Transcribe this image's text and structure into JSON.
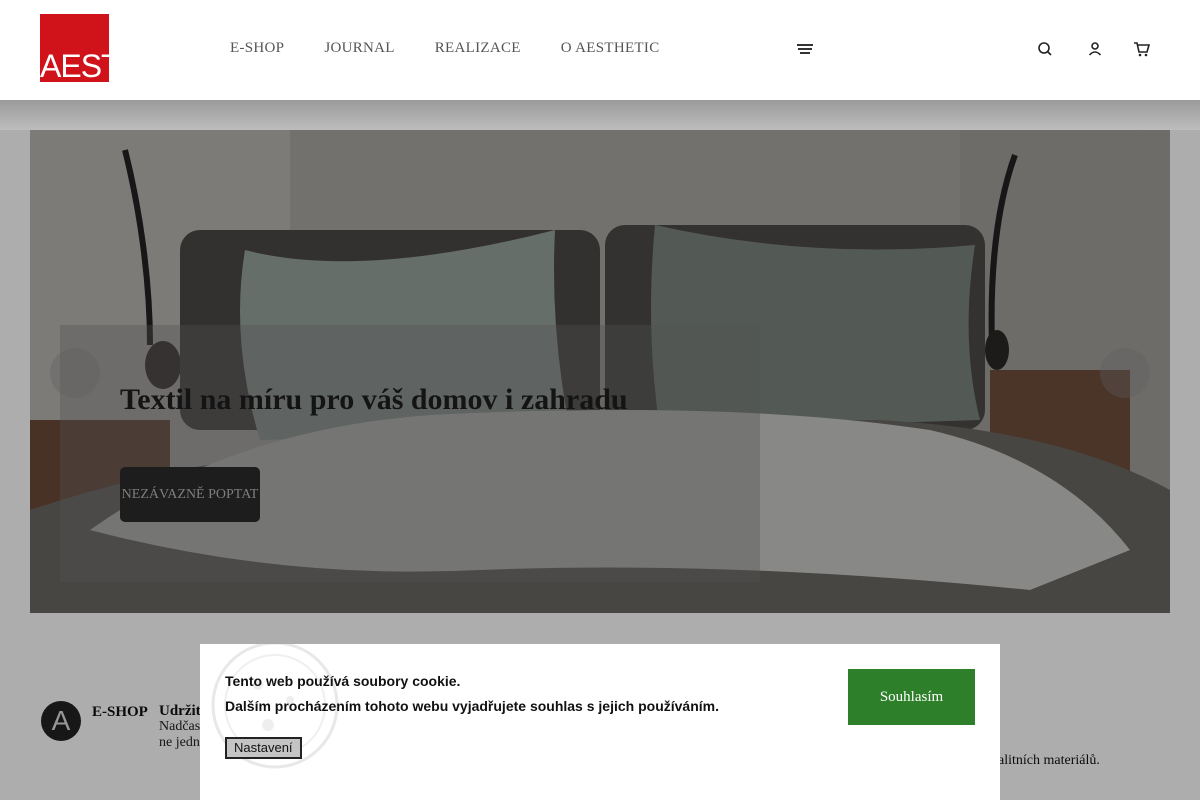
{
  "header": {
    "logo_text": "AEST",
    "nav": [
      "E-SHOP",
      "JOURNAL",
      "REALIZACE",
      "O AESTHETIC"
    ],
    "brand_color": "#d0121b"
  },
  "hero": {
    "title": "Textil na míru pro váš domov i zahradu",
    "button": "NEZÁVAZNĚ POPTAT",
    "prev_icon": "",
    "next_icon": ""
  },
  "feature": {
    "avatar": "A",
    "label": "E-SHOP",
    "heading": "Udržite",
    "text_1": "Nadčas",
    "text_2": "ne jedn",
    "right_text": "alitních materiálů."
  },
  "cookie": {
    "line_1": "Tento web používá soubory cookie.",
    "line_2": "Dalším procházením tohoto webu vyjadřujete souhlas s jejich používáním.",
    "settings": "Nastavení",
    "accept": "Souhlasím",
    "accept_color": "#2d7f2a"
  }
}
